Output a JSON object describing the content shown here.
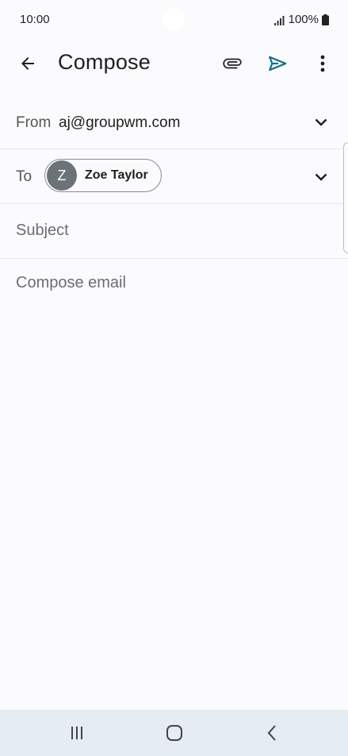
{
  "status_bar": {
    "time": "10:00",
    "battery": "100%",
    "signal_icon": "signal-icon",
    "battery_icon": "battery-icon"
  },
  "app_bar": {
    "title": "Compose",
    "back_icon": "arrow-back-icon",
    "attach_icon": "paperclip-icon",
    "send_icon": "send-icon",
    "more_icon": "more-vert-icon",
    "send_color": "#0b6e8a"
  },
  "from": {
    "label": "From",
    "value": "aj@groupwm.com"
  },
  "to": {
    "label": "To",
    "recipients": [
      {
        "initial": "Z",
        "name": "Zoe Taylor"
      }
    ]
  },
  "subject": {
    "placeholder": "Subject",
    "value": ""
  },
  "body": {
    "placeholder": "Compose email",
    "value": ""
  },
  "nav_bar": {
    "recents_icon": "recents-icon",
    "home_icon": "home-icon",
    "back_icon": "nav-back-icon"
  }
}
